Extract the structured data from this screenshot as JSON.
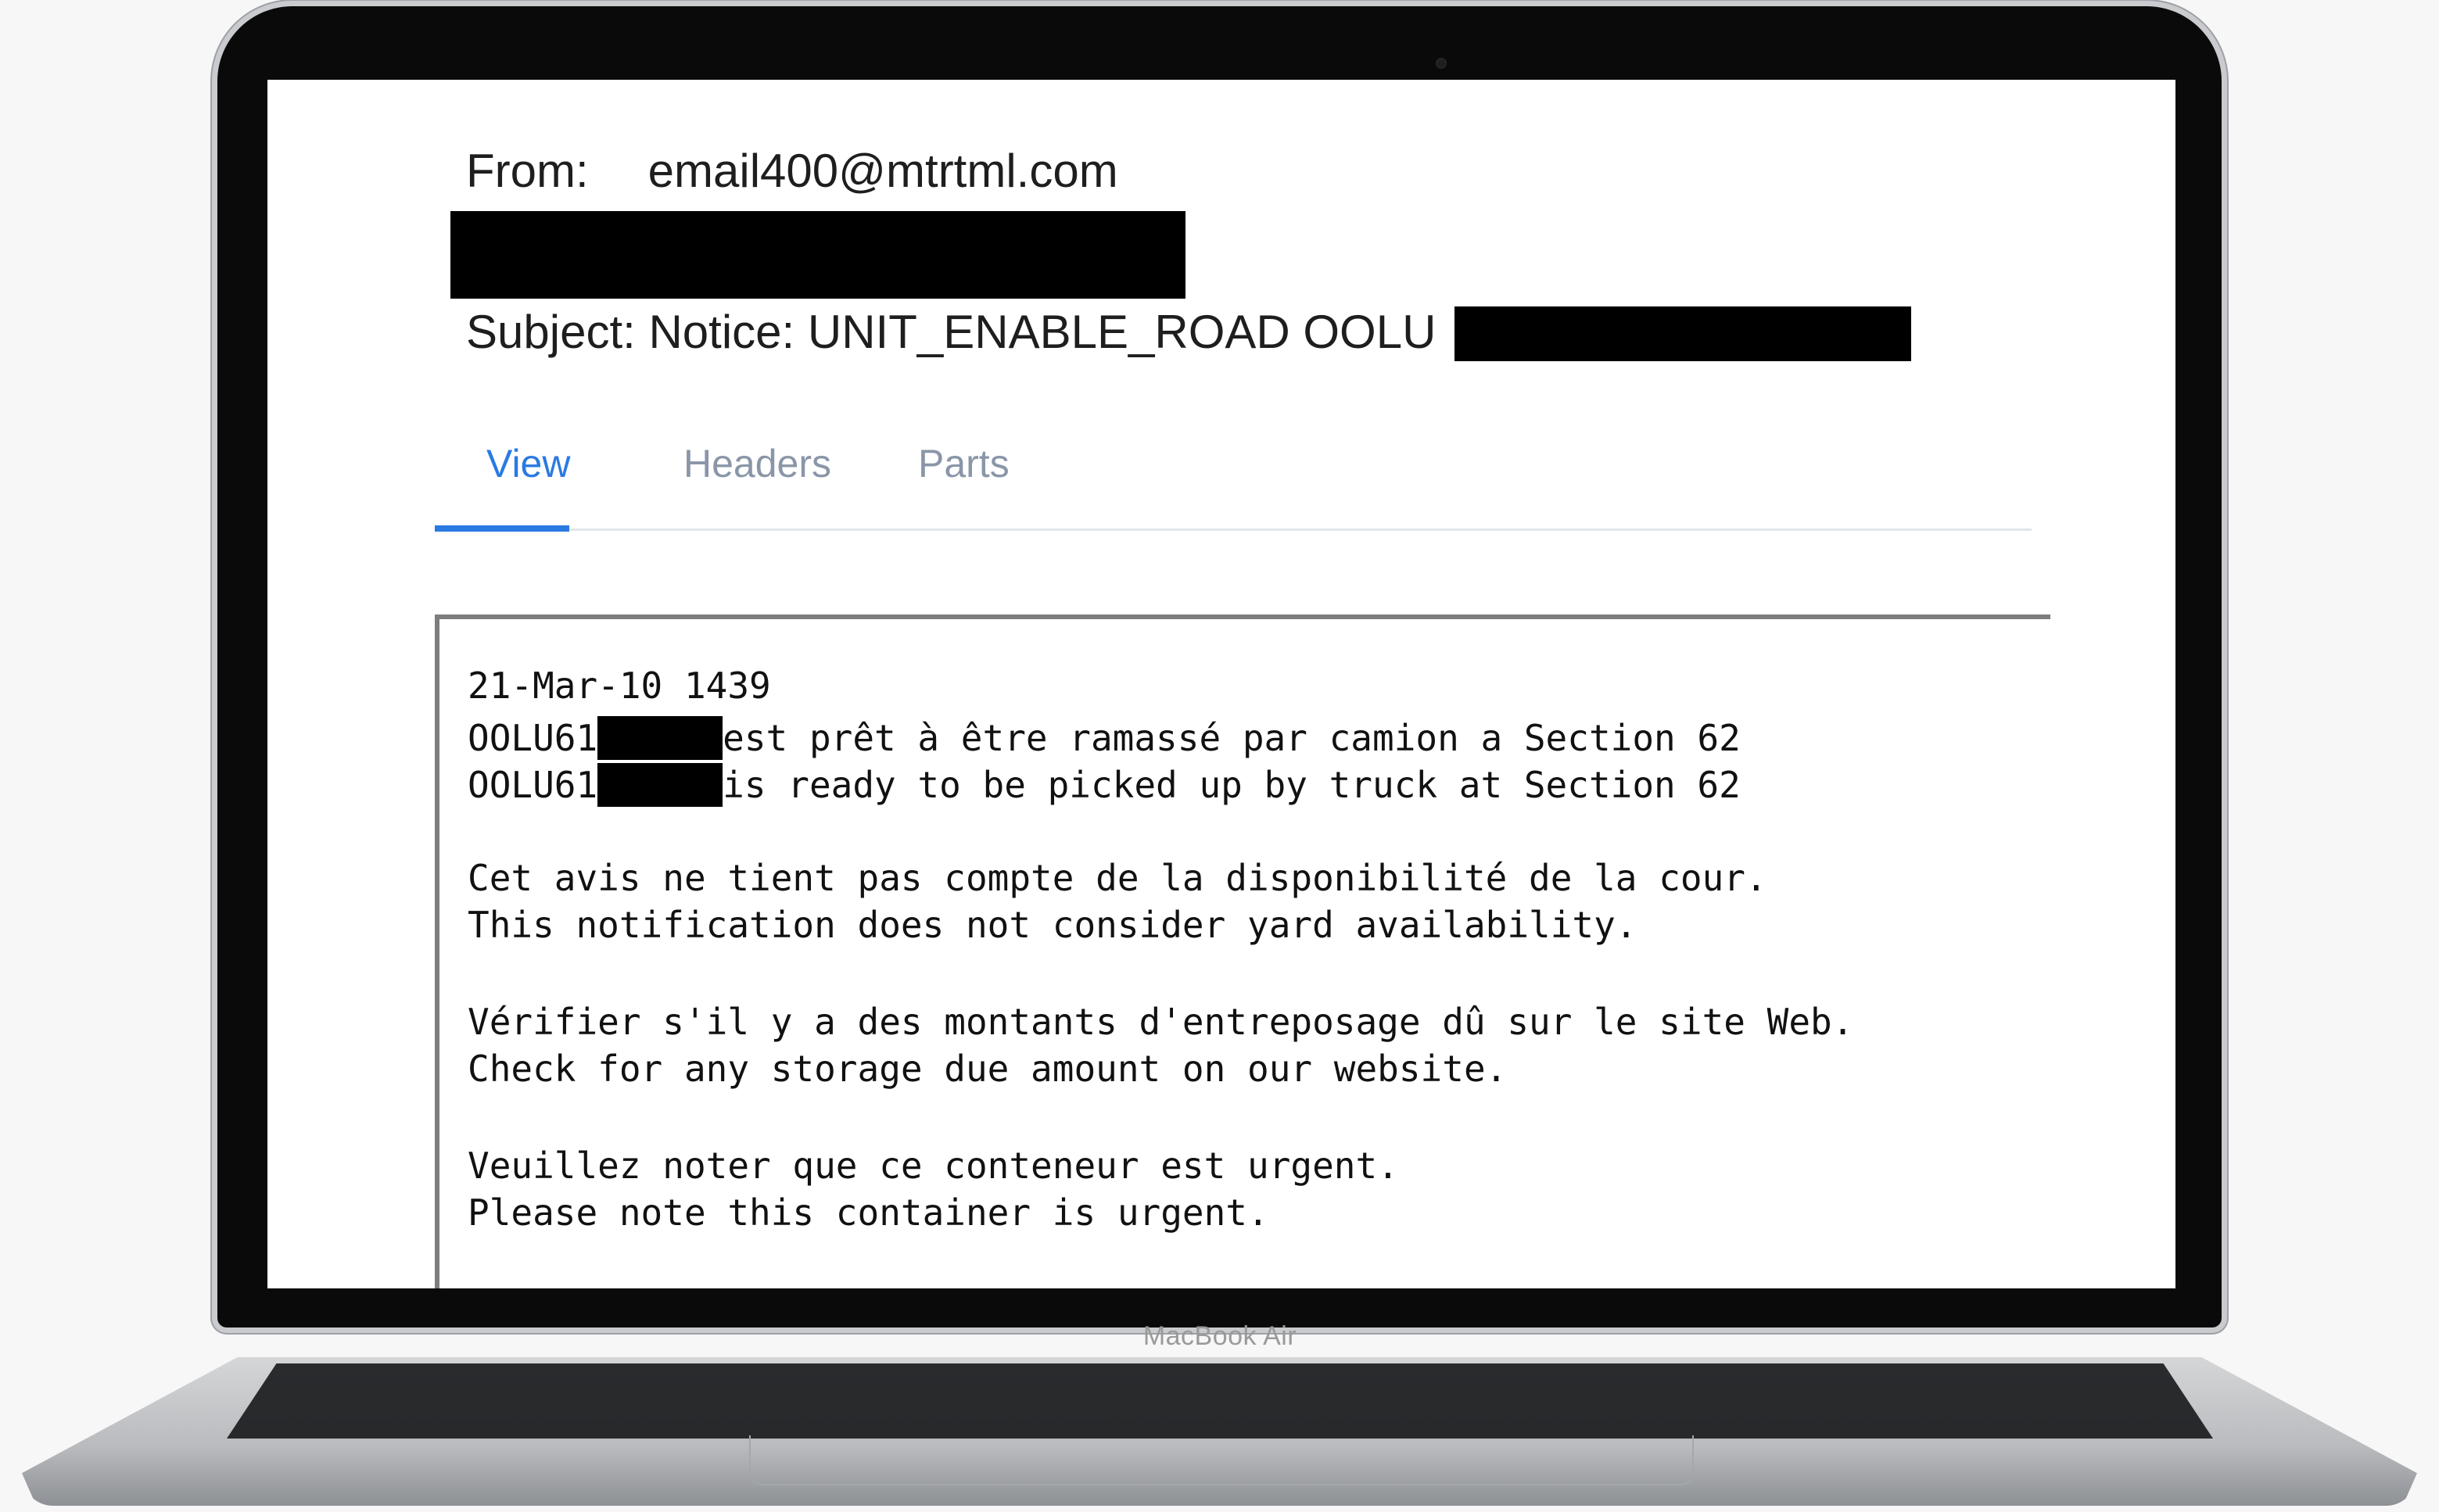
{
  "device": {
    "brand_label": "MacBook Air"
  },
  "email": {
    "from_label": "From:",
    "from_value": "email400@mtrtml.com",
    "subject": "Subject: Notice: UNIT_ENABLE_ROAD OOLU"
  },
  "tabs": [
    {
      "label": "View",
      "active": true
    },
    {
      "label": "Headers",
      "active": false
    },
    {
      "label": "Parts",
      "active": false
    }
  ],
  "message": {
    "timestamp": "21-Mar-10 1439",
    "unit_prefix": "OOLU61",
    "line_fr_ready": "est prêt à être ramassé par camion a Section 62",
    "line_en_ready": "is ready to be picked up by truck at Section 62",
    "line_fr_yard": "Cet avis ne tient pas compte de la disponibilité de la cour.",
    "line_en_yard": "This notification does not consider yard availability.",
    "line_fr_storage": "Vérifier s'il y a des montants d'entreposage dû sur le site Web.",
    "line_en_storage": "Check for any storage due amount on our website.",
    "line_fr_urgent": "Veuillez noter que ce conteneur est urgent.",
    "line_en_urgent": "Please note this container is urgent."
  },
  "colors": {
    "tab_active": "#2a7ae2",
    "tab_inactive": "#8a96a8",
    "redaction": "#000000"
  }
}
